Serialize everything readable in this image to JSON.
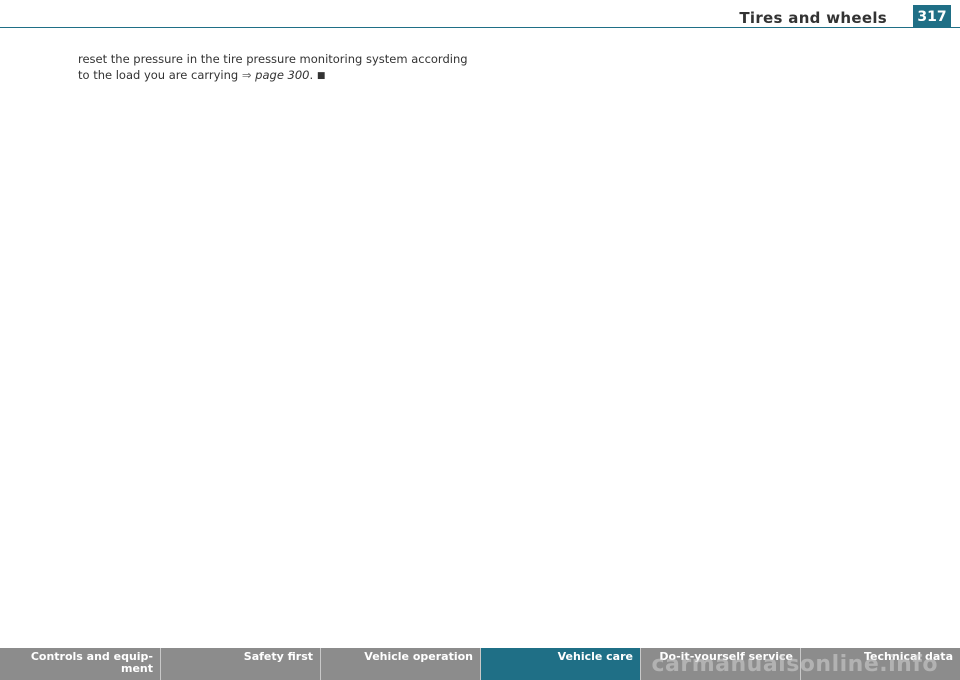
{
  "header": {
    "section_title": "Tires and wheels",
    "page_number": "317"
  },
  "body": {
    "line1": "reset the pressure in the tire pressure monitoring system according",
    "line2_prefix": "to the load you are carrying ",
    "arrow": "⇒",
    "page_ref": "page 300",
    "line2_suffix": ". ",
    "end_mark": "■"
  },
  "footer": {
    "tabs": [
      {
        "label": "Controls and equip-\nment",
        "active": false
      },
      {
        "label": "Safety first",
        "active": false
      },
      {
        "label": "Vehicle operation",
        "active": false
      },
      {
        "label": "Vehicle care",
        "active": true
      },
      {
        "label": "Do-it-yourself service",
        "active": false
      },
      {
        "label": "Technical data",
        "active": false
      }
    ]
  },
  "watermark": "carmanualsonline.info",
  "colors": {
    "accent": "#1f6f86",
    "footer_gray": "#8c8c8c"
  }
}
